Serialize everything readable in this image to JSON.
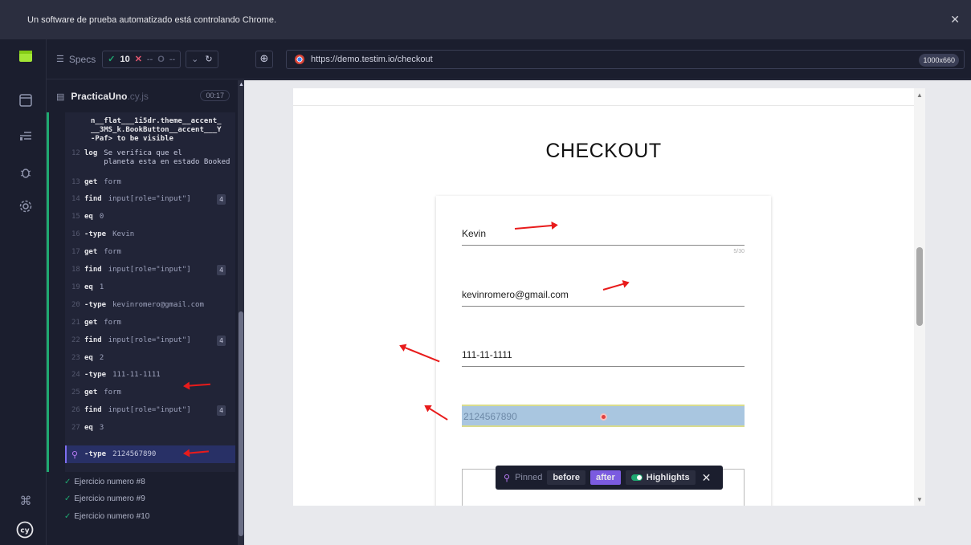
{
  "automation_bar": {
    "message": "Un software de prueba automatizado está controlando Chrome.",
    "close": "✕"
  },
  "nav": {
    "logo": "cy"
  },
  "reporter_header": {
    "specs_label": "Specs",
    "passed": "10",
    "failed_icon": "✕",
    "failed": "--",
    "pending_icon": "O",
    "pending": "--"
  },
  "spec": {
    "name": "PracticaUno",
    "ext": ".cy.js",
    "duration": "00:17"
  },
  "commands_top": [
    "n__flat___1i5dr.theme__accent_",
    "__3MS_k.BookButton__accent___Y",
    "-Paf> to be visible"
  ],
  "commands": [
    {
      "num": "12",
      "kw": "log",
      "arg": "Se verifica que el",
      "arg2": "planeta esta en estado Booked"
    },
    {
      "num": "13",
      "kw": "get",
      "arg": "form"
    },
    {
      "num": "14",
      "kw": "find",
      "arg": "input[role=\"input\"]",
      "badge": "4"
    },
    {
      "num": "15",
      "kw": "eq",
      "arg": "0"
    },
    {
      "num": "16",
      "kw": "-type",
      "arg": "Kevin"
    },
    {
      "num": "17",
      "kw": "get",
      "arg": "form"
    },
    {
      "num": "18",
      "kw": "find",
      "arg": "input[role=\"input\"]",
      "badge": "4"
    },
    {
      "num": "19",
      "kw": "eq",
      "arg": "1"
    },
    {
      "num": "20",
      "kw": "-type",
      "arg": "kevinromero@gmail.com"
    },
    {
      "num": "21",
      "kw": "get",
      "arg": "form"
    },
    {
      "num": "22",
      "kw": "find",
      "arg": "input[role=\"input\"]",
      "badge": "4"
    },
    {
      "num": "23",
      "kw": "eq",
      "arg": "2"
    },
    {
      "num": "24",
      "kw": "-type",
      "arg": "111-11-1111"
    },
    {
      "num": "25",
      "kw": "get",
      "arg": "form"
    },
    {
      "num": "26",
      "kw": "find",
      "arg": "input[role=\"input\"]",
      "badge": "4"
    },
    {
      "num": "27",
      "kw": "eq",
      "arg": "3"
    }
  ],
  "selected_command": {
    "icon": "⚲",
    "kw": "-type",
    "arg": "2124567890"
  },
  "other_tests": [
    "Ejercicio numero #8",
    "Ejercicio numero #9",
    "Ejercicio numero #10"
  ],
  "url_bar": {
    "url": "https://demo.testim.io/checkout",
    "viewport": "1000x660"
  },
  "app": {
    "title": "CHECKOUT",
    "fields": [
      {
        "value": "Kevin",
        "counter": "5/30"
      },
      {
        "value": "kevinromero@gmail.com"
      },
      {
        "value": "111-11-1111"
      }
    ],
    "highlighted_field": {
      "value": "2124567890"
    }
  },
  "snapshot_bar": {
    "pinned": "Pinned",
    "before": "before",
    "after": "after",
    "highlights": "Highlights",
    "close": "✕"
  },
  "colors": {
    "pass": "#1fa971",
    "fail": "#e45770",
    "accent": "#7b5be0",
    "arrow": "#e81b1b"
  }
}
